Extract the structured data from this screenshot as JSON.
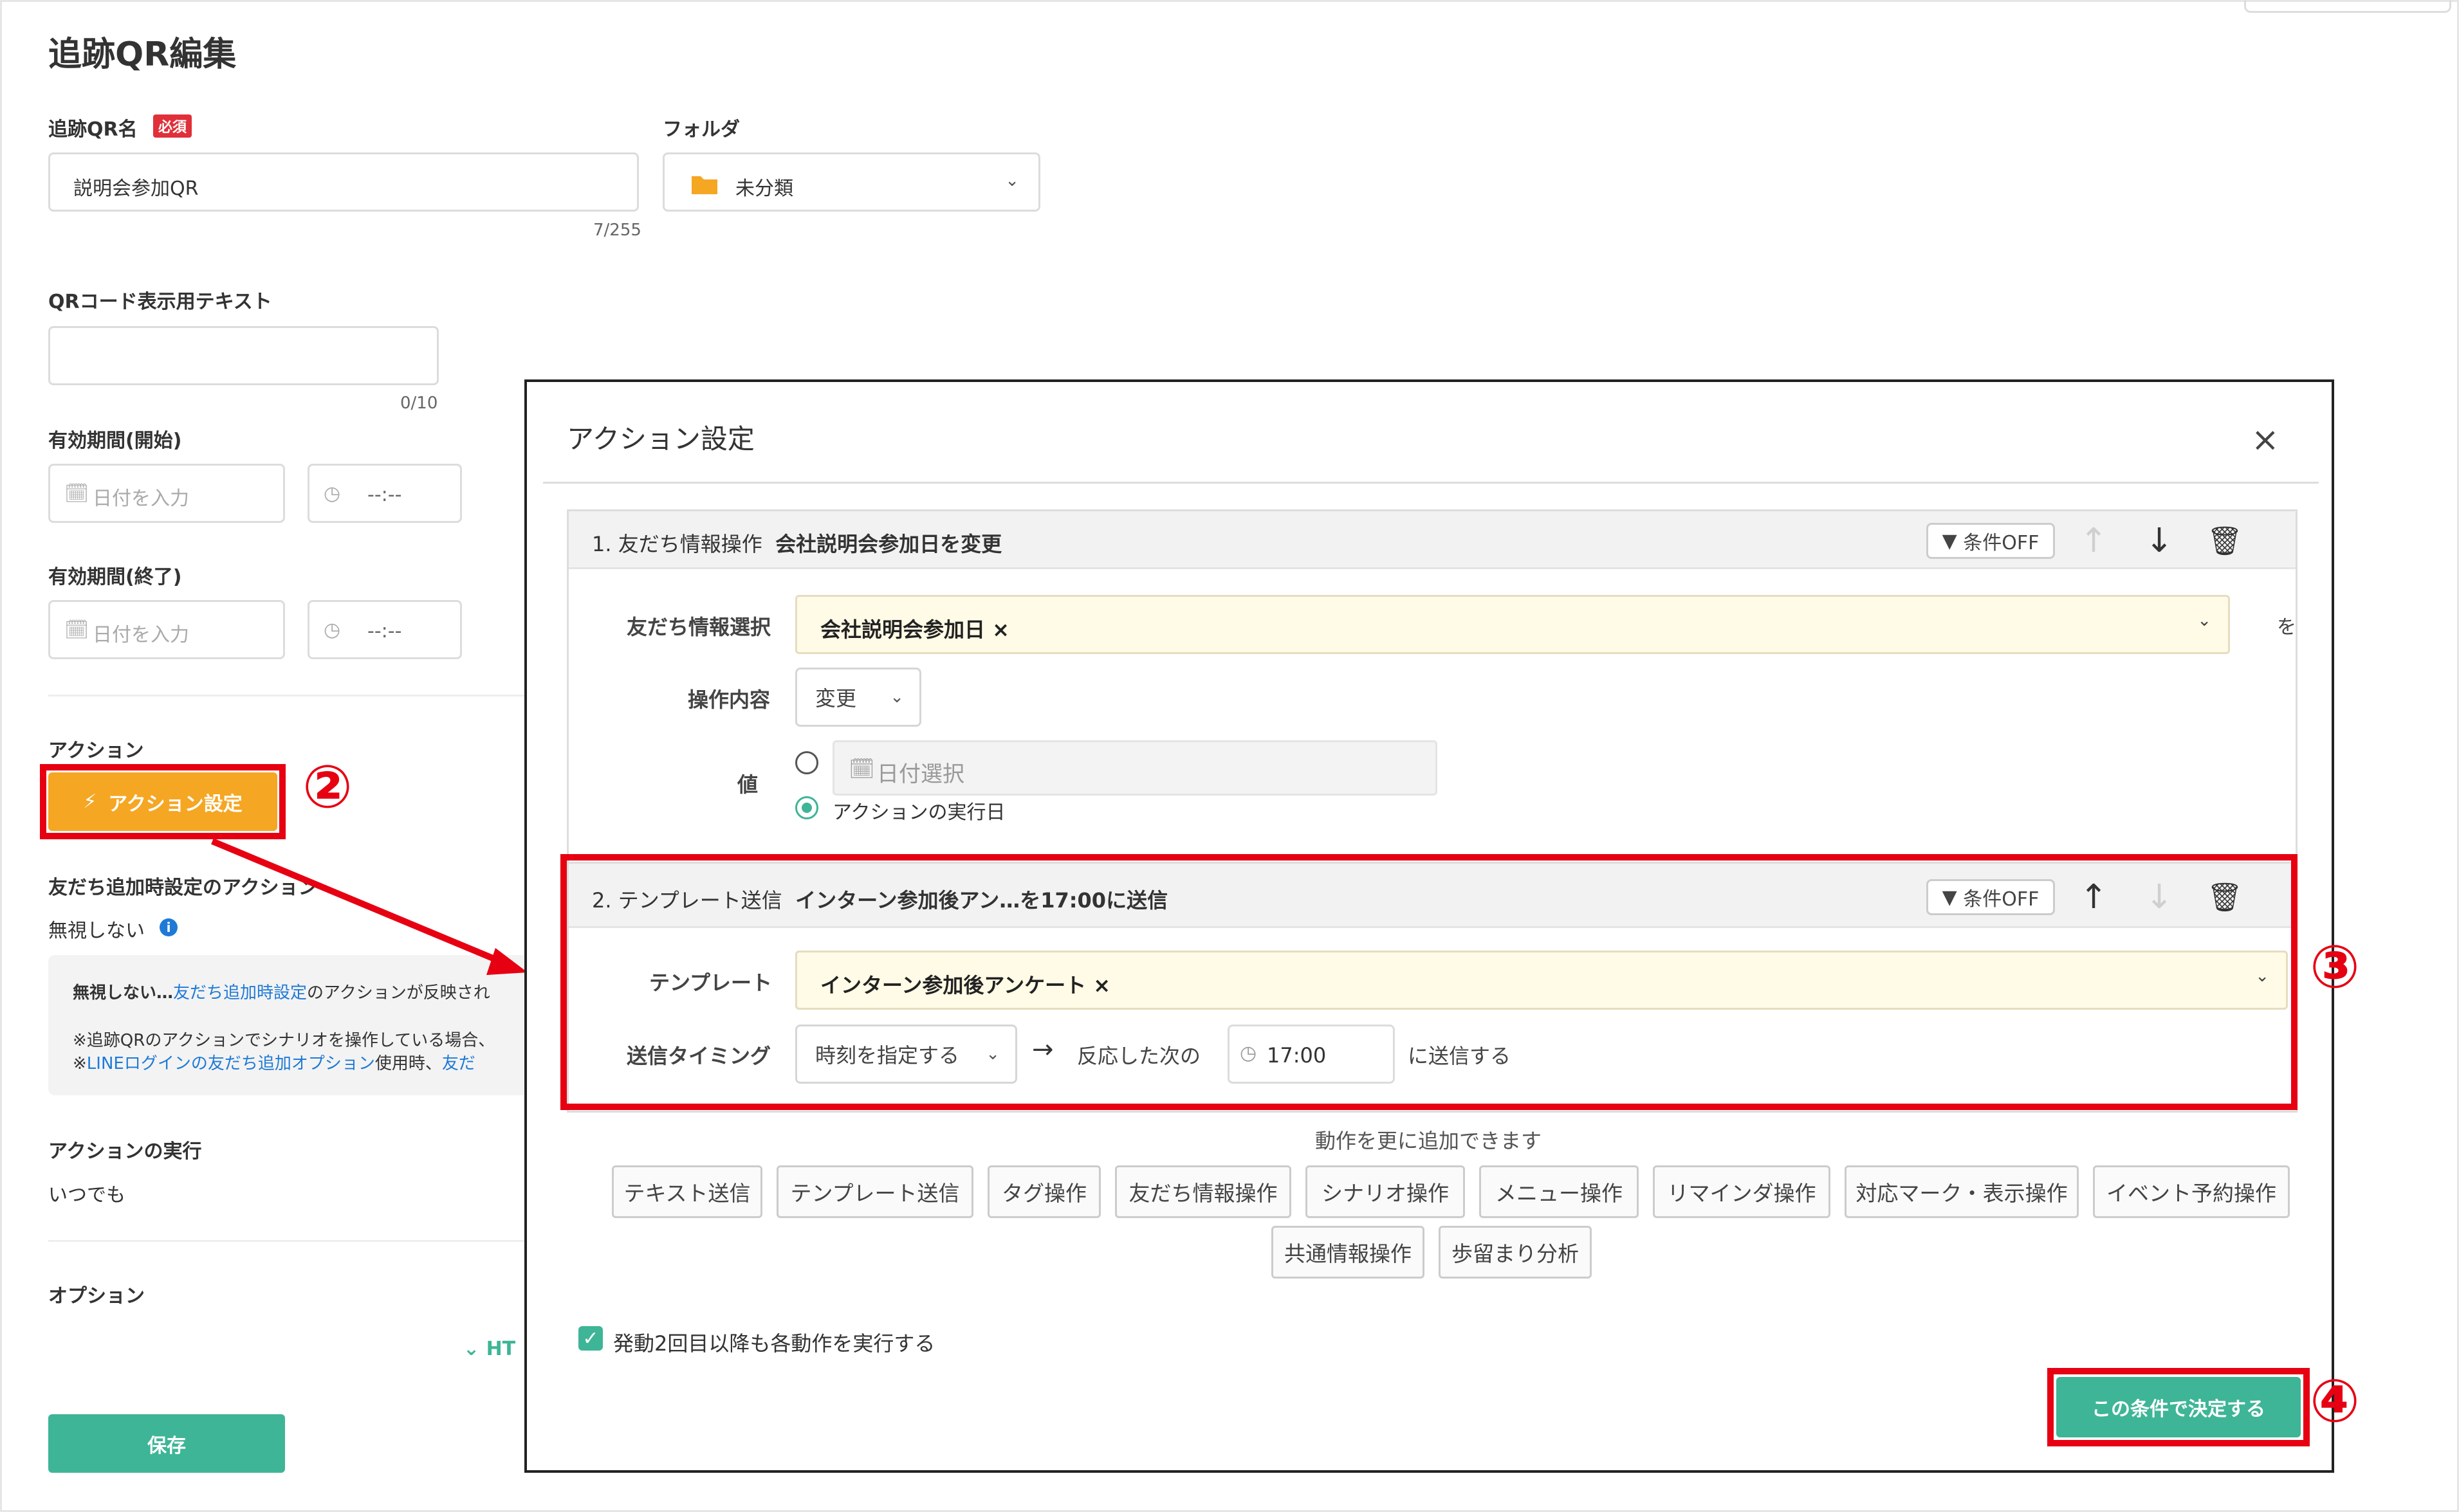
{
  "page": {
    "title": "追跡QR編集",
    "qr_name_label": "追跡QR名",
    "required_badge": "必須",
    "qr_name_value": "説明会参加QR",
    "qr_name_counter": "7/255",
    "folder_label": "フォルダ",
    "folder_value": "未分類",
    "qr_text_label": "QRコード表示用テキスト",
    "qr_text_counter": "0/10",
    "valid_start_label": "有効期間(開始)",
    "valid_end_label": "有効期間(終了)",
    "date_placeholder": "日付を入力",
    "time_placeholder": "--:--",
    "action_label": "アクション",
    "action_button": "アクション設定",
    "friend_add_label": "友だち追加時設定のアクション",
    "friend_add_value": "無視しない",
    "info_box": {
      "line1_prefix": "無視しない…",
      "line1_link": "友だち追加時設定",
      "line1_suffix": "のアクションが反映され",
      "line2": "※追跡QRのアクションでシナリオを操作している場合、",
      "line3_prefix": "※",
      "line3_link": "LINEログインの友だち追加オプション",
      "line3_suffix": "使用時、",
      "line3_link2": "友だ"
    },
    "action_exec_label": "アクションの実行",
    "action_exec_value": "いつでも",
    "option_label": "オプション",
    "html_toggle": "HT",
    "save_button": "保存"
  },
  "modal": {
    "title": "アクション設定",
    "close_icon": "×",
    "block1": {
      "header_num": "1. 友だち情報操作",
      "header_desc": "会社説明会参加日を変更",
      "cond_button": "条件OFF",
      "field_label": "友だち情報選択",
      "field_value": "会社説明会参加日 ×",
      "field_suffix": "を",
      "op_label": "操作内容",
      "op_value": "変更",
      "value_label": "値",
      "date_select_placeholder": "日付選択",
      "radio2_label": "アクションの実行日"
    },
    "block2": {
      "header_num": "2. テンプレート送信",
      "header_desc": "インターン参加後アン…を17:00に送信",
      "cond_button": "条件OFF",
      "template_label": "テンプレート",
      "template_value": "インターン参加後アンケート ×",
      "timing_label": "送信タイミング",
      "timing_value": "時刻を指定する",
      "next_reaction": "反応した次の",
      "time_value": "17:00",
      "send_suffix": "に送信する"
    },
    "add_more_text": "動作を更に追加できます",
    "action_chips_row1": [
      "テキスト送信",
      "テンプレート送信",
      "タグ操作",
      "友だち情報操作",
      "シナリオ操作",
      "メニュー操作",
      "リマインダ操作",
      "対応マーク・表示操作",
      "イベント予約操作"
    ],
    "action_chips_row2": [
      "共通情報操作",
      "歩留まり分析"
    ],
    "repeat_checkbox_label": "発動2回目以降も各動作を実行する",
    "confirm_button": "この条件で決定する"
  },
  "annotations": {
    "step2": "②",
    "step3": "③",
    "step4": "④"
  },
  "colors": {
    "accent_green": "#3eb596",
    "accent_orange": "#f5a623",
    "annotation_red": "#e60012",
    "required_red": "#e0303a",
    "link_blue": "#1e7ad6"
  }
}
